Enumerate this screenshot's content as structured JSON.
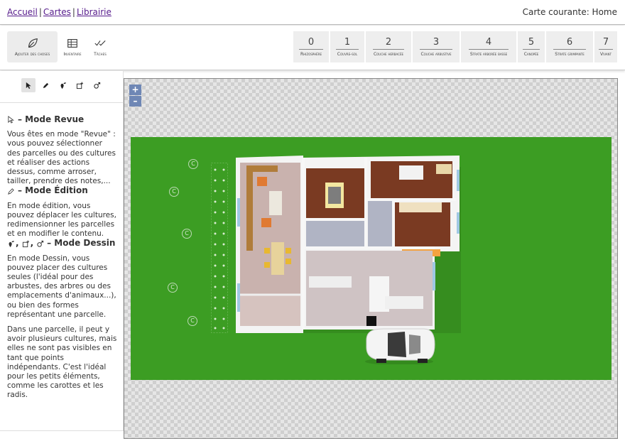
{
  "breadcrumb": {
    "items": [
      "Accueil",
      "Cartes",
      "Librairie"
    ],
    "separator": "|"
  },
  "current_map": "Carte courante: Home",
  "toolbar": {
    "buttons": [
      {
        "label": "Ajouter des choses",
        "icon": "leaf-icon",
        "active": true
      },
      {
        "label": "Inventaire",
        "icon": "table-icon",
        "active": false
      },
      {
        "label": "Tâches",
        "icon": "checkmarks-icon",
        "active": false
      }
    ]
  },
  "layers": [
    {
      "num": "0",
      "label": "Rhizosphère"
    },
    {
      "num": "1",
      "label": "Couvre-sol"
    },
    {
      "num": "2",
      "label": "Couche herbacée"
    },
    {
      "num": "3",
      "label": "Couche arbustive"
    },
    {
      "num": "4",
      "label": "Strate arborée basse"
    },
    {
      "num": "5",
      "label": "Canopée"
    },
    {
      "num": "6",
      "label": "Strate grimpante"
    },
    {
      "num": "7",
      "label": "Vivant"
    }
  ],
  "tools": [
    "cursor-icon",
    "pencil-icon",
    "plant-pin-icon",
    "add-shape-icon",
    "animal-icon"
  ],
  "help": {
    "review_title": "– Mode Revue",
    "review_text": "Vous êtes en mode \"Revue\" : vous pouvez sélectionner des parcelles ou des cultures et réaliser des actions dessus, comme arroser, tailler, prendre des notes,...",
    "edit_title": "– Mode Édition",
    "edit_text": "En mode édition, vous pouvez déplacer les cultures, redimensionner les parcelles et en modifier le contenu.",
    "draw_title": "– Mode Dessin",
    "draw_title_sep": ",",
    "draw_text": "En mode Dessin, vous pouvez placer des cultures seules (l'idéal pour des arbustes, des arbres ou des emplacements d'animaux...), ou bien des formes représentant une parcelle.",
    "parcel_text": "Dans une parcelle, il peut y avoir plusieurs cultures, mais elles ne sont pas visibles en tant que points indépendants. C'est l'idéal pour les petits éléments, comme les carottes et les radis."
  },
  "map": {
    "zoom_in": "+",
    "zoom_out": "–",
    "crop_marker": "C",
    "colors": {
      "lawn": "#3c9d23",
      "zoom_button": "#6f87b5"
    }
  }
}
